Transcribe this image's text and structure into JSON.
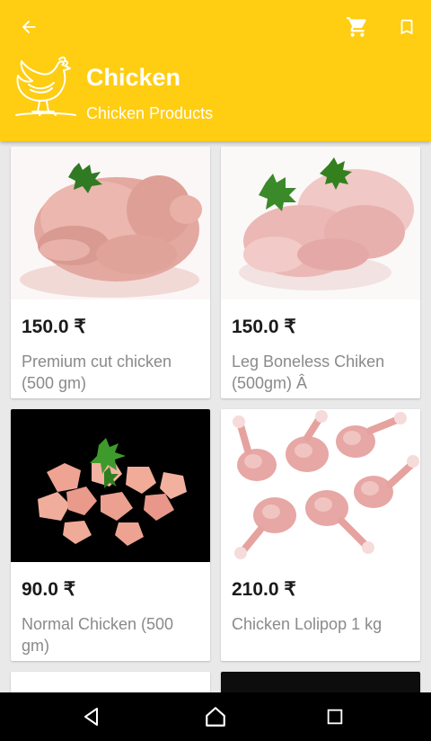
{
  "header": {
    "title": "Chicken",
    "subtitle": "Chicken Products",
    "icons": [
      "arrow-back-icon",
      "cart-icon",
      "bookmark-icon",
      "hen-logo-icon"
    ],
    "color": "#ffcd12"
  },
  "products": [
    {
      "price": "150.0 ₹",
      "name": "Premium cut chicken (500 gm)"
    },
    {
      "price": "150.0 ₹",
      "name": "Leg Boneless Chiken (500gm) Â"
    },
    {
      "price": "90.0 ₹",
      "name": "Normal Chicken (500 gm)"
    },
    {
      "price": "210.0 ₹",
      "name": "Chicken Lolipop 1 kg"
    }
  ],
  "navbar": {
    "icons": [
      "nav-back-icon",
      "nav-home-icon",
      "nav-recents-icon"
    ]
  }
}
